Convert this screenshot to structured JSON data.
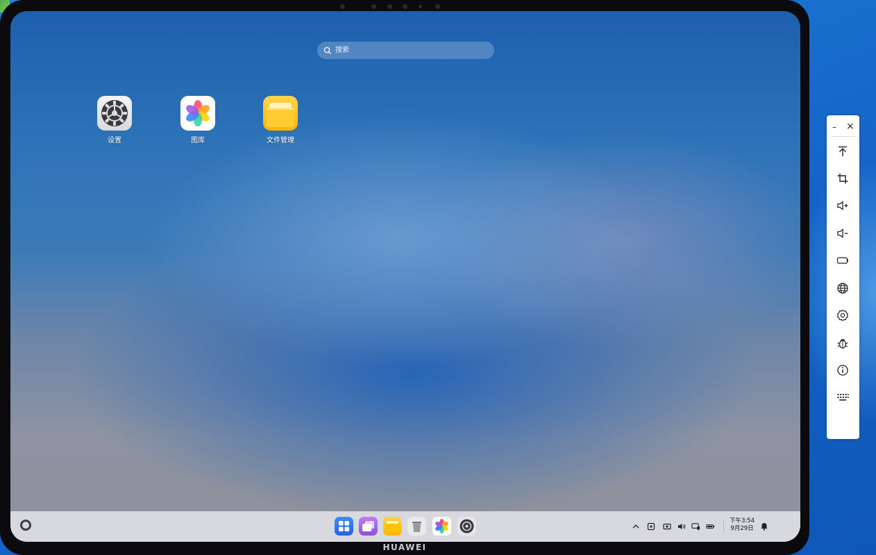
{
  "device": {
    "brand": "HUAWEI"
  },
  "search": {
    "placeholder": "搜索"
  },
  "desktop_icons": [
    {
      "label": "设置",
      "icon": "settings-gear-icon"
    },
    {
      "label": "图库",
      "icon": "gallery-flower-icon"
    },
    {
      "label": "文件管理",
      "icon": "folder-icon"
    }
  ],
  "dock": {
    "apps": [
      "app-center-icon",
      "multitask-icon",
      "file-manager-icon",
      "trash-icon",
      "gallery-icon",
      "settings-icon"
    ],
    "tray": [
      "chevron-up-icon",
      "input-method-icon",
      "screen-capture-icon",
      "volume-icon",
      "cast-icon",
      "battery-icon"
    ],
    "time": "下午3:54",
    "date": "9月29日",
    "notification_icon": "bell-icon"
  },
  "toolbar": {
    "minimize": "–",
    "close": "×",
    "buttons": [
      "upload-icon",
      "crop-icon",
      "volume-up-icon",
      "volume-down-icon",
      "power-icon",
      "globe-icon",
      "settings-icon",
      "bug-icon",
      "info-icon",
      "keyboard-icon"
    ]
  }
}
